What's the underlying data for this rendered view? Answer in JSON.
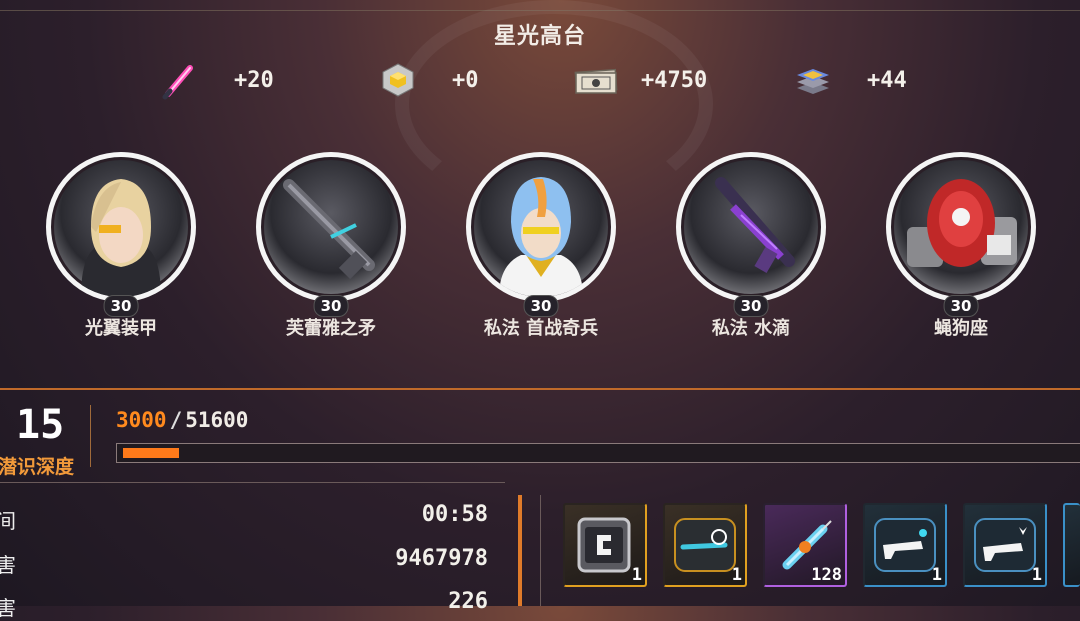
{
  "header": {
    "title": "星光高台"
  },
  "rewards": [
    {
      "icon": "pink-lightstick-icon",
      "value": "+20"
    },
    {
      "icon": "gold-cube-icon",
      "value": "+0"
    },
    {
      "icon": "ticket-stack-icon",
      "value": "+4750"
    },
    {
      "icon": "blue-chip-stack-icon",
      "value": "+44"
    }
  ],
  "characters": [
    {
      "name": "光翼装甲",
      "level": "30",
      "portrait": "blonde-girl-portrait"
    },
    {
      "name": "芙蕾雅之矛",
      "level": "30",
      "portrait": "rifle-weapon-portrait"
    },
    {
      "name": "私法 首战奇兵",
      "level": "30",
      "portrait": "blue-haired-portrait"
    },
    {
      "name": "私法 水滴",
      "level": "30",
      "portrait": "purple-rifle-portrait"
    },
    {
      "name": "蝇狗座",
      "level": "30",
      "portrait": "red-mech-portrait"
    }
  ],
  "depth": {
    "value": "15",
    "label": "潜识深度",
    "progress_current": "3000",
    "progress_separator": "/",
    "progress_max": "51600",
    "progress_fraction": 0.058
  },
  "stats": [
    {
      "label": "间",
      "value": "00:58"
    },
    {
      "label": "害",
      "value": "9467978"
    },
    {
      "label": "害",
      "value": "226"
    }
  ],
  "items": [
    {
      "icon": "supply-crate-icon",
      "count": "1",
      "rarity_color": "#e0a020"
    },
    {
      "icon": "scope-module-icon",
      "count": "1",
      "rarity_color": "#e0a020"
    },
    {
      "icon": "syringe-icon",
      "count": "128",
      "rarity_color": "#b060e0"
    },
    {
      "icon": "blue-gun-icon",
      "count": "1",
      "rarity_color": "#3a90c8"
    },
    {
      "icon": "gun-spark-icon",
      "count": "1",
      "rarity_color": "#3a90c8"
    },
    {
      "icon": "partial-item-icon",
      "count": "",
      "rarity_color": "#3a90c8"
    }
  ]
}
